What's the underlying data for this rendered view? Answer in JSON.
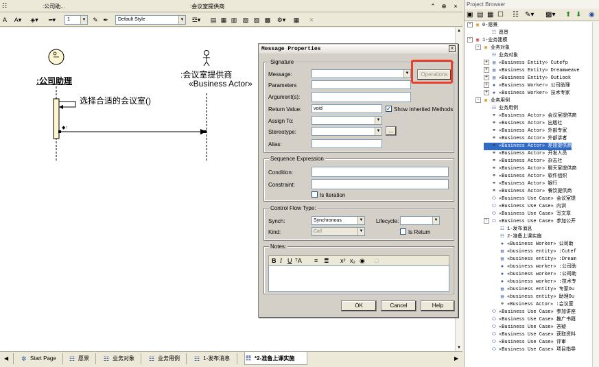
{
  "window": {
    "diagram_titles": [
      ":公司助...",
      ":会议室提供商"
    ]
  },
  "toolbar": {
    "zoom_value": "1",
    "style_value": "Default Style"
  },
  "diagram": {
    "actor1_label": ":公司助理",
    "actor2_label": ":会议室提供商",
    "actor2_stereotype": "«Business Actor»",
    "self_message": "选择合适的会议室()"
  },
  "dialog": {
    "title": "Message Properties",
    "signature_legend": "Signature",
    "message_label": "Message:",
    "operations_button": "Operations",
    "parameters_label": "Parameters",
    "arguments_label": "Argument(s):",
    "return_value_label": "Return Value:",
    "return_value": "void",
    "show_inherited_label": "Show Inherited Methods",
    "assign_to_label": "Assign To:",
    "stereotype_label": "Stereotype:",
    "stereotype_button": "...",
    "alias_label": "Alias:",
    "sequence_legend": "Sequence Expression",
    "condition_label": "Condition:",
    "constraint_label": "Constraint:",
    "iteration_label": "Is Iteration",
    "control_flow_legend": "Control Flow Type:",
    "synch_label": "Synch:",
    "synch_value": "Synchronous",
    "lifecycle_label": "Lifecycle:",
    "kind_label": "Kind:",
    "kind_value": "Call",
    "is_return_label": "Is Return",
    "notes_legend": "Notes:",
    "ok_button": "OK",
    "cancel_button": "Cancel",
    "help_button": "Help"
  },
  "tabs": [
    "Start Page",
    "愿景",
    "业务对象",
    "业务用例",
    "1-发布消息",
    "*2-准备上课实施"
  ],
  "browser": {
    "title": "Project Browser",
    "tree": [
      "0-愿景",
      "愿景",
      "1-业务建模",
      "业务对象",
      "业务对象",
      "«Business Entity» Cutefp",
      "«Business Entity» Dreamweave",
      "«Business Entity» OutLook",
      "«Business Worker» 公司助理",
      "«Business Worker» 技术专家",
      "业务用例",
      "业务用例",
      "«Business Actor» 会议室提供商",
      "«Business Actor» 出版社",
      "«Business Actor» 外部专家",
      "«Business Actor» 外部讲者",
      "«Business Actor» 差旅提供商",
      "«Business Actor» 开发人员",
      "«Business Actor» 杂志社",
      "«Business Actor» 聊天室提供商",
      "«Business Actor» 软件组织",
      "«Business Actor» 银行",
      "«Business Actor» 餐饮提供商",
      "«Business Use Case» 会议室提",
      "«Business Use Case» 内训",
      "«Business Use Case» 写文章",
      "«Business Use Case» 参加公开",
      "1-发布消息",
      "2-准备上课实施",
      "«Business Worker» 公司助",
      "«business entity» :Cutef",
      "«business entity» :Dream",
      "«business worker» :公司助",
      "«business worker» :公司助",
      "«business worker» :技术专",
      "«business entity» 专家Ou",
      "«business entity» 助理Ou",
      "«Business Actor» :会议室",
      "«Business Use Case» 参加讲座",
      "«Business Use Case» 推广书籍",
      "«Business Use Case» 答疑",
      "«Business Use Case» 获取资料",
      "«Business Use Case» 评审",
      "«Business Use Case» 项目指导"
    ]
  }
}
